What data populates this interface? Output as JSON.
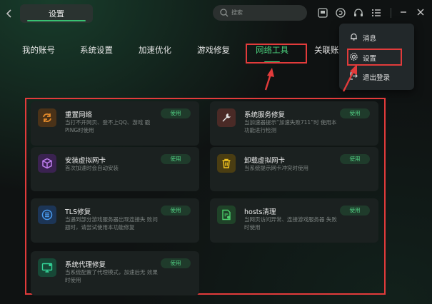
{
  "header": {
    "title": "设置",
    "search_placeholder": "搜索"
  },
  "tabs": [
    {
      "label": "我的账号",
      "active": false
    },
    {
      "label": "系统设置",
      "active": false
    },
    {
      "label": "加速优化",
      "active": false
    },
    {
      "label": "游戏修复",
      "active": false
    },
    {
      "label": "网络工具",
      "active": true
    },
    {
      "label": "关联账号",
      "active": false
    }
  ],
  "menu": {
    "items": [
      {
        "label": "消息",
        "icon": "bell-icon"
      },
      {
        "label": "设置",
        "icon": "gear-icon"
      },
      {
        "label": "退出登录",
        "icon": "logout-icon"
      }
    ]
  },
  "tools": [
    {
      "name": "重置网络",
      "desc": "当打不开网页、登不上QQ、游戏 戳PING时使用",
      "button": "使用",
      "icon": "reset-network-icon",
      "color": "#d07a26"
    },
    {
      "name": "系统服务修复",
      "desc": "当加速器提示“加速失败711”时 使用本功能进行检测",
      "button": "使用",
      "icon": "wrench-icon",
      "color": "#c85a4c"
    },
    {
      "name": "安装虚拟网卡",
      "desc": "首次加速时会自动安装",
      "button": "使用",
      "icon": "cube-icon",
      "color": "#9b4fd1"
    },
    {
      "name": "卸载虚拟网卡",
      "desc": "当系统提示网卡冲突时使用",
      "button": "使用",
      "icon": "trash-icon",
      "color": "#d1a520"
    },
    {
      "name": "TLS修复",
      "desc": "当遇到部分游戏服务器出现连接失 败问题时，请尝试使用本功能修复",
      "button": "使用",
      "icon": "tls-icon",
      "color": "#2e7fd6"
    },
    {
      "name": "hosts清理",
      "desc": "当网页访问异常、连接游戏服务器 失败时使用",
      "button": "使用",
      "icon": "hosts-file-icon",
      "color": "#3aa55a"
    },
    {
      "name": "系统代理修复",
      "desc": "当系统配置了代理模式，加速后无 效果时使用",
      "button": "使用",
      "icon": "proxy-monitor-icon",
      "color": "#22b07a"
    }
  ],
  "colors": {
    "accent": "#4cd37e",
    "highlight": "#e23b3b",
    "background": "#0f1212"
  }
}
